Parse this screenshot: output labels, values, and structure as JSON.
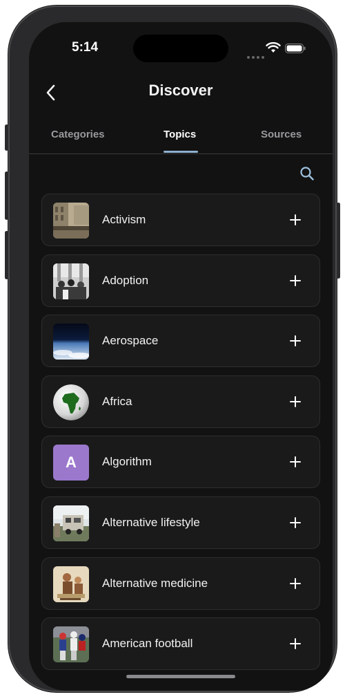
{
  "status_bar": {
    "time": "5:14"
  },
  "header": {
    "title": "Discover",
    "back_icon": "chevron-left-icon"
  },
  "tabs": [
    {
      "label": "Categories",
      "active": false
    },
    {
      "label": "Topics",
      "active": true
    },
    {
      "label": "Sources",
      "active": false
    }
  ],
  "search": {
    "icon": "search-icon"
  },
  "topics": [
    {
      "label": "Activism",
      "thumb": "photo-street-crowd"
    },
    {
      "label": "Adoption",
      "thumb": "photo-bw-group"
    },
    {
      "label": "Aerospace",
      "thumb": "photo-earth-from-space"
    },
    {
      "label": "Africa",
      "thumb": "globe-africa-icon"
    },
    {
      "label": "Algorithm",
      "thumb": "letter-avatar",
      "letter": "A",
      "avatar_color": "#9b78cc"
    },
    {
      "label": "Alternative lifestyle",
      "thumb": "photo-camper-trailer"
    },
    {
      "label": "Alternative medicine",
      "thumb": "photo-vintage-illustration"
    },
    {
      "label": "American football",
      "thumb": "photo-football-players"
    }
  ],
  "add_icon": "plus-icon",
  "colors": {
    "background": "#121212",
    "card": "#1a1a1b",
    "tab_indicator": "#8fb1d0",
    "text": "#f2f2f2"
  }
}
